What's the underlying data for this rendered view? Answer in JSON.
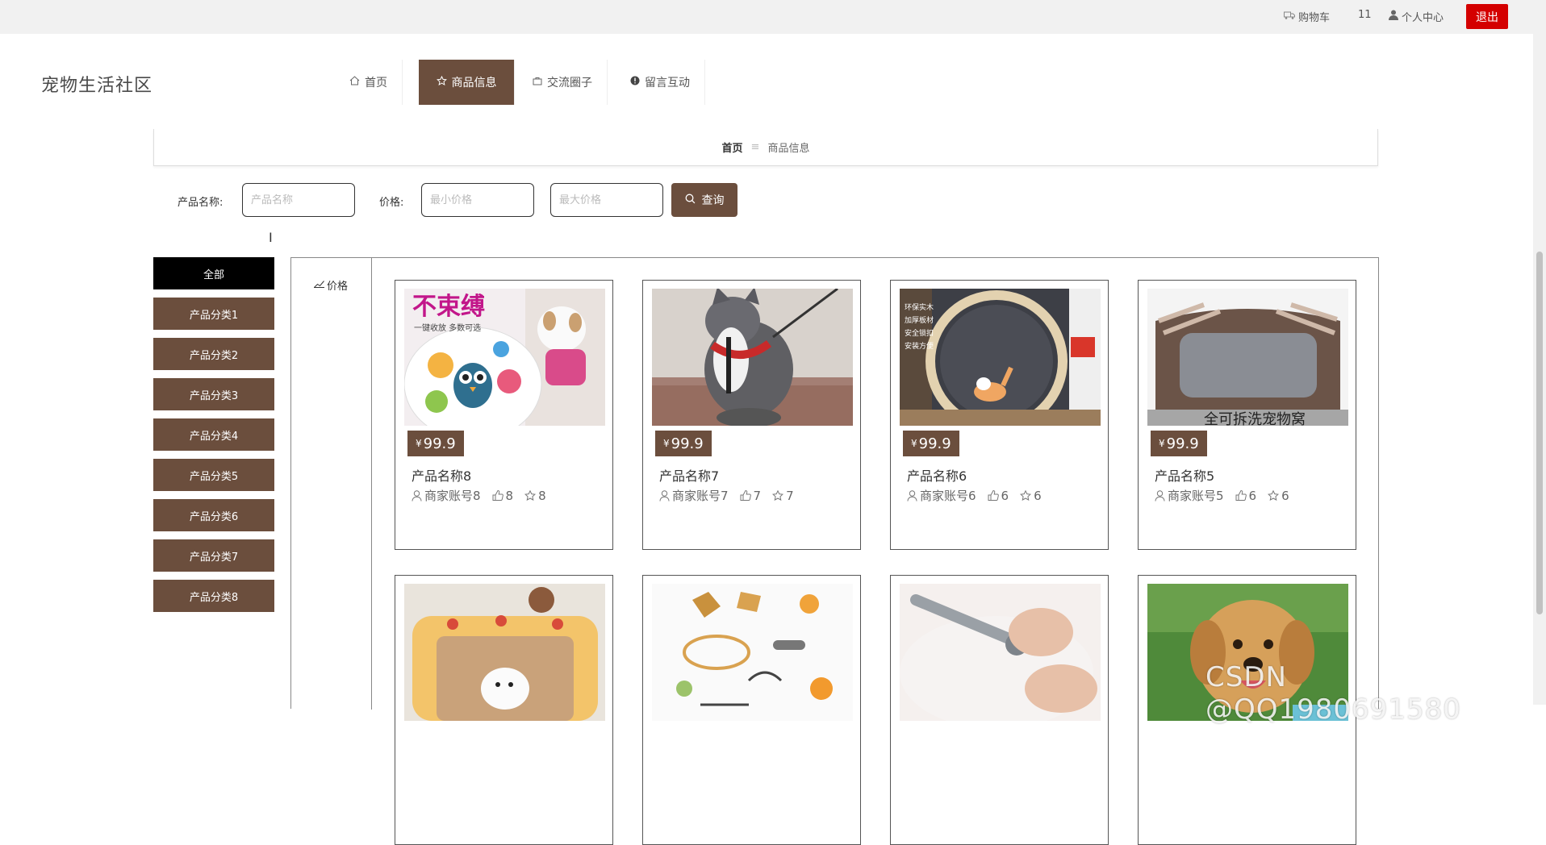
{
  "topbar": {
    "cart_label": "购物车",
    "cart_count": "11",
    "profile_label": "个人中心",
    "logout_label": "退出"
  },
  "header": {
    "site_title": "宠物生活社区",
    "nav": [
      {
        "label": "首页",
        "icon": "home-icon"
      },
      {
        "label": "商品信息",
        "icon": "star-icon"
      },
      {
        "label": "交流圈子",
        "icon": "bag-icon"
      },
      {
        "label": "留言互动",
        "icon": "info-icon"
      }
    ]
  },
  "breadcrumb": {
    "home": "首页",
    "sep": "≡",
    "current": "商品信息"
  },
  "search": {
    "name_label": "产品名称:",
    "name_placeholder": "产品名称",
    "price_label": "价格:",
    "min_placeholder": "最小价格",
    "max_placeholder": "最大价格",
    "query_label": "查询"
  },
  "categories": [
    "全部",
    "产品分类1",
    "产品分类2",
    "产品分类3",
    "产品分类4",
    "产品分类5",
    "产品分类6",
    "产品分类7",
    "产品分类8"
  ],
  "sort_label": "价格",
  "products": [
    {
      "name": "产品名称8",
      "price": "99.9",
      "currency": "¥",
      "seller": "商家账号8",
      "likes": "8",
      "favs": "8",
      "image": "retractable-leash-photo"
    },
    {
      "name": "产品名称7",
      "price": "99.9",
      "currency": "¥",
      "seller": "商家账号7",
      "likes": "7",
      "favs": "7",
      "image": "cat-harness-photo"
    },
    {
      "name": "产品名称6",
      "price": "99.9",
      "currency": "¥",
      "seller": "商家账号6",
      "likes": "6",
      "favs": "6",
      "image": "cat-wheel-photo"
    },
    {
      "name": "产品名称5",
      "price": "99.9",
      "currency": "¥",
      "seller": "商家账号5",
      "likes": "6",
      "favs": "6",
      "image": "pet-bed-photo"
    },
    {
      "image": "dog-bed-mat-photo"
    },
    {
      "image": "dog-toys-illustration"
    },
    {
      "image": "nail-clipper-photo"
    },
    {
      "image": "golden-retriever-photo"
    }
  ],
  "image_text": {
    "leash_banner": "不束缚",
    "leash_sub": "一键收放 多数可选",
    "bed_banner": "全可拆洗宠物窝",
    "wheel_side": "环保实木 加厚板材 安全锁扣 安装方便"
  },
  "watermark": "CSDN @QQ1980691580",
  "colors": {
    "accent": "#6b4e3d",
    "logout": "#d40000",
    "active_category": "#000000"
  }
}
